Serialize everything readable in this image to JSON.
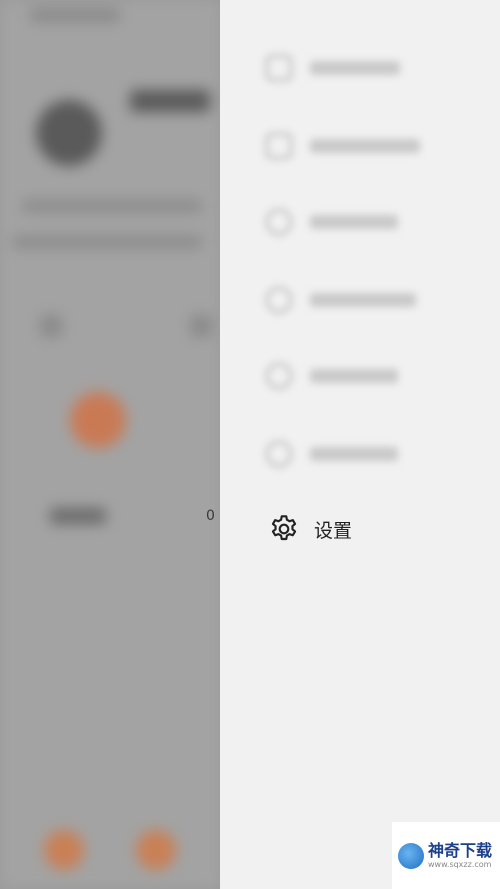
{
  "drawer": {
    "settings_label": "设置"
  },
  "background": {
    "visible_count": "0"
  },
  "watermark": {
    "brand": "神奇下载",
    "url": "www.sqxzz.com"
  }
}
